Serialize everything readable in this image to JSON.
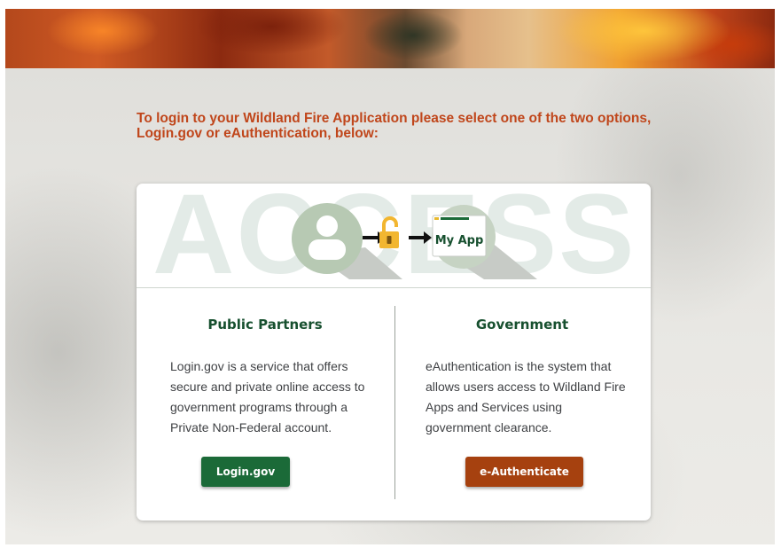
{
  "headline": "To login to your Wildland Fire Application please select one of the two options, Login.gov or eAuthentication, below:",
  "hero": {
    "watermark": "ACCESS",
    "app_label": "My App",
    "icons": [
      "user-icon",
      "arrow-right-icon",
      "unlocked-padlock-icon",
      "app-window-icon"
    ]
  },
  "public": {
    "title": "Public Partners",
    "description": "Login.gov is a service that offers secure and private online access to government programs through a Private Non-Federal account.",
    "button": "Login.gov"
  },
  "government": {
    "title": "Government",
    "description": "eAuthentication is the system that allows users access to Wildland Fire Apps and Services using government clearance.",
    "button": "e-Authenticate"
  },
  "colors": {
    "headline": "#c0461b",
    "title_green": "#17502f",
    "login_button": "#1b6a38",
    "eauth_button": "#a6410f",
    "lock": "#f2b630"
  }
}
